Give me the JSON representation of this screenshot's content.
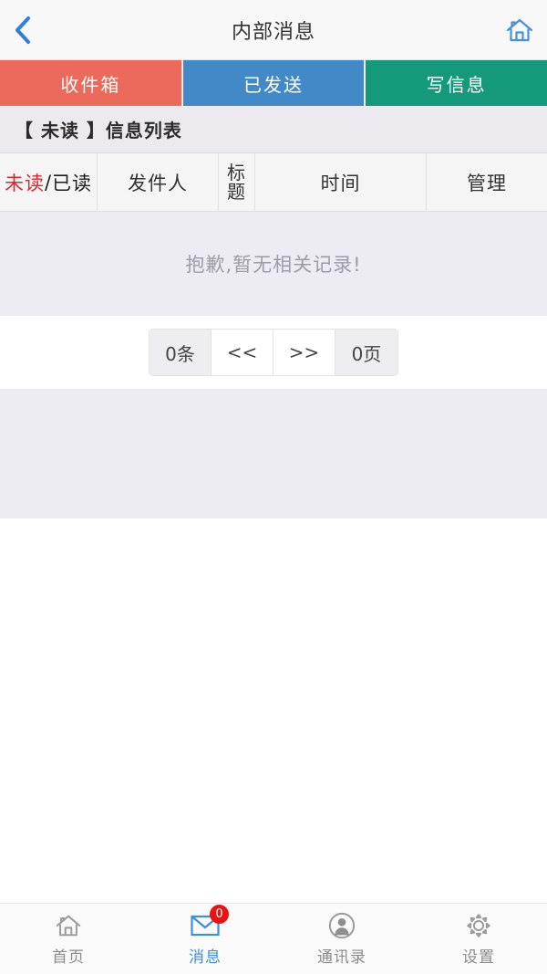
{
  "header": {
    "title": "内部消息",
    "back_icon": "chevron-left-icon",
    "home_icon": "home-icon",
    "accent_color": "#2f80d8"
  },
  "tabs": [
    {
      "label": "收件箱",
      "color": "#ec6a5b",
      "active": true
    },
    {
      "label": "已发送",
      "color": "#4289c8",
      "active": false
    },
    {
      "label": "写信息",
      "color": "#15997b",
      "active": false
    }
  ],
  "list": {
    "title_prefix": "【 未读 】",
    "title_suffix": "信息列表",
    "title_full": "【 未读 】信息列表",
    "columns": {
      "status_unread": "未读",
      "status_divider": "/",
      "status_read": "已读",
      "sender": "发件人",
      "subject": "标题",
      "time": "时间",
      "manage": "管理"
    },
    "empty_text": "抱歉,暂无相关记录!",
    "unread_color": "#e0262b"
  },
  "pager": {
    "total": "0条",
    "prev": "<<",
    "next": ">>",
    "pages": "0页"
  },
  "bottom_nav": [
    {
      "label": "首页",
      "icon": "home-icon",
      "active": false,
      "badge": null
    },
    {
      "label": "消息",
      "icon": "envelope-icon",
      "active": true,
      "badge": "0"
    },
    {
      "label": "通讯录",
      "icon": "contacts-person-icon",
      "active": false,
      "badge": null
    },
    {
      "label": "设置",
      "icon": "gear-icon",
      "active": false,
      "badge": null
    }
  ]
}
